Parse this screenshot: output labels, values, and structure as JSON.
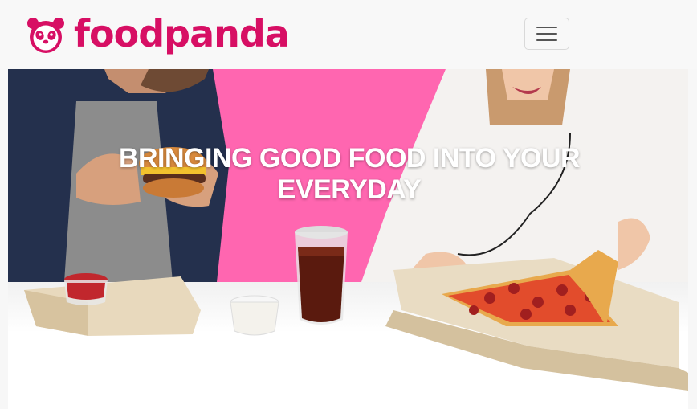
{
  "brand": {
    "name": "foodpanda",
    "color": "#d70f64",
    "icon": "panda-logo-icon"
  },
  "nav": {
    "toggle_icon": "hamburger-menu-icon"
  },
  "hero": {
    "title": "BRINGING GOOD FOOD INTO YOUR EVERYDAY",
    "background_color": "#ff66b0"
  }
}
